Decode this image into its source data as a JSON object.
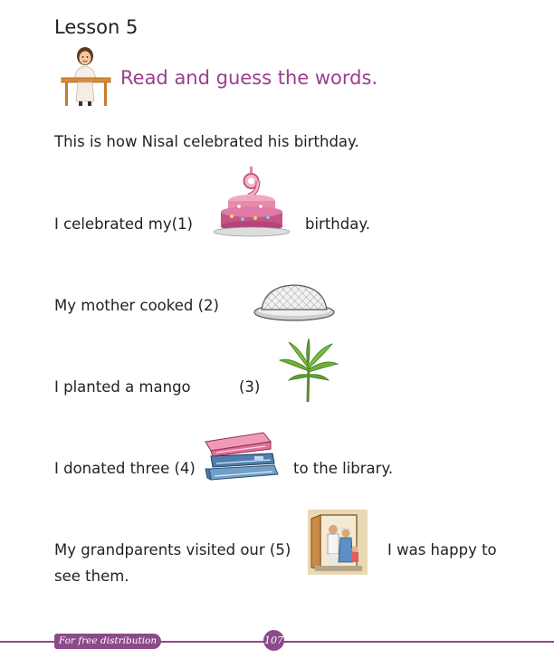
{
  "header": {
    "lesson_title": "Lesson 5",
    "instruction": "Read and guess the words."
  },
  "intro": "This is how Nisal celebrated his birthday.",
  "sentences": [
    {
      "before": "I  celebrated my(1)",
      "after": "birthday.",
      "picture": "birthday-cake-number-9"
    },
    {
      "before": "My mother cooked  (2)",
      "after": "",
      "picture": "rice-plate-dome"
    },
    {
      "before": "I planted a mango",
      "number": "(3)",
      "after": "",
      "picture": "mango-plant"
    },
    {
      "before": "I donated three (4)",
      "after": "to the library.",
      "picture": "stack-of-books"
    },
    {
      "before": "My grandparents visited our (5)",
      "after": "I was happy to",
      "continuation": "see them.",
      "picture": "grandparents-at-door"
    }
  ],
  "footer": {
    "distribution": "For free distribution",
    "page_number": "107"
  },
  "colors": {
    "accent": "#9b3e8d",
    "footer": "#8b4a8a"
  }
}
